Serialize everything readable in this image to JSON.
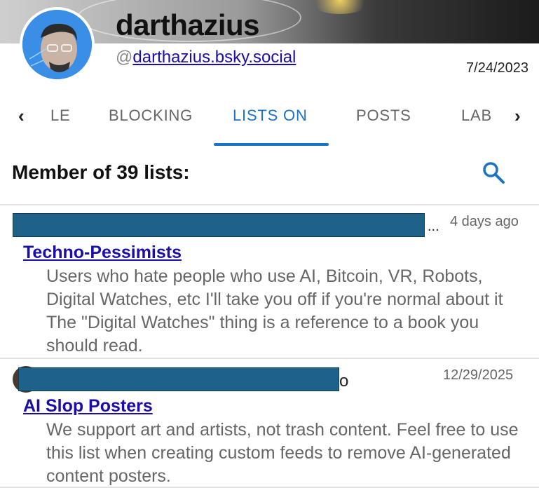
{
  "profile": {
    "display_name": "darthazius",
    "handle_prefix": "@",
    "handle": "darthazius.bsky.social",
    "date": "7/24/2023"
  },
  "tabs": {
    "left_chevron_icon": "chevron-left-icon",
    "right_chevron_icon": "chevron-right-icon",
    "items": [
      {
        "label": "LE"
      },
      {
        "label": "BLOCKING"
      },
      {
        "label": "LISTS ON",
        "active": true
      },
      {
        "label": "POSTS"
      },
      {
        "label": "LAB"
      }
    ]
  },
  "section": {
    "title": "Member of 39 lists:",
    "search_icon": "search-icon",
    "accent_color": "#1a73c6"
  },
  "lists": [
    {
      "time": "4 days ago",
      "ellipsis": "...",
      "title": "Techno-Pessimists",
      "description": "Users who hate people who use AI, Bitcoin, VR, Robots, Digital Watches, etc I'll take you off if you're normal about it The \"Digital Watches\" thing is a reference to a book you should read."
    },
    {
      "time": "12/29/2025",
      "trailing_char": "o",
      "title": "AI Slop Posters",
      "description": "We support art and artists, not trash content. Feel free to use this list when creating custom feeds to remove AI-generated content posters."
    }
  ]
}
